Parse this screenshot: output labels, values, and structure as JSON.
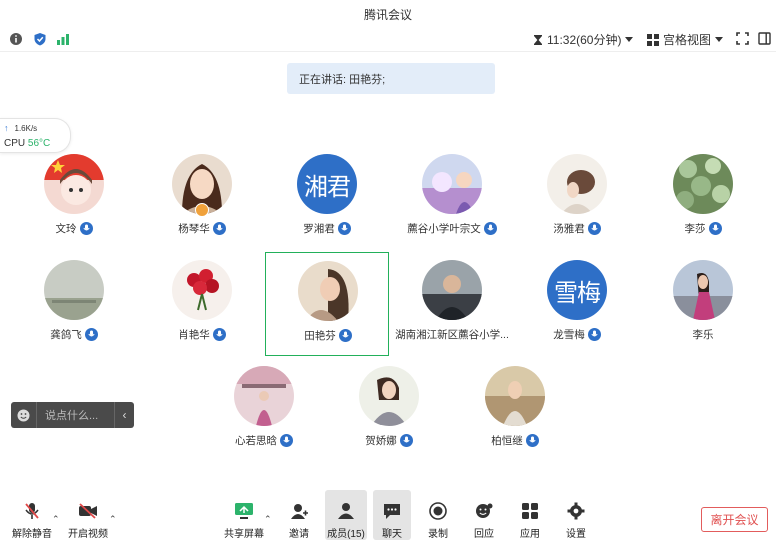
{
  "window": {
    "title": "腾讯会议"
  },
  "topbar": {
    "timer": "11:32(60分钟)",
    "view_label": "宫格视图"
  },
  "speaking": {
    "text": "正在讲话: 田艳芬;"
  },
  "network": {
    "upload_speed": "1.6K/s",
    "cpu_label": "CPU",
    "cpu_temp": "56°C"
  },
  "participants": [
    {
      "name": "文玲"
    },
    {
      "name": "杨琴华"
    },
    {
      "name": "罗湘君",
      "avatar_text": "湘君"
    },
    {
      "name": "藨谷小学叶宗文"
    },
    {
      "name": "汤雅君"
    },
    {
      "name": "李莎"
    },
    {
      "name": "龚鸽飞"
    },
    {
      "name": "肖艳华"
    },
    {
      "name": "田艳芬"
    },
    {
      "name": "湖南湘江新区藨谷小学..."
    },
    {
      "name": "龙雪梅",
      "avatar_text": "雪梅"
    },
    {
      "name": "李乐"
    },
    {
      "name": "心若思晗"
    },
    {
      "name": "贺娇娜"
    },
    {
      "name": "柏恒继"
    }
  ],
  "chat": {
    "placeholder": "说点什么..."
  },
  "bottombar": {
    "unmute": "解除静音",
    "start_video": "开启视频",
    "share_screen": "共享屏幕",
    "invite": "邀请",
    "members": "成员(15)",
    "chat": "聊天",
    "record": "录制",
    "playback": "回应",
    "apps": "应用",
    "settings": "设置",
    "leave": "离开会议"
  },
  "colors": {
    "accent": "#2e6fc7",
    "active_border": "#22b05a",
    "leave": "#e05050"
  }
}
